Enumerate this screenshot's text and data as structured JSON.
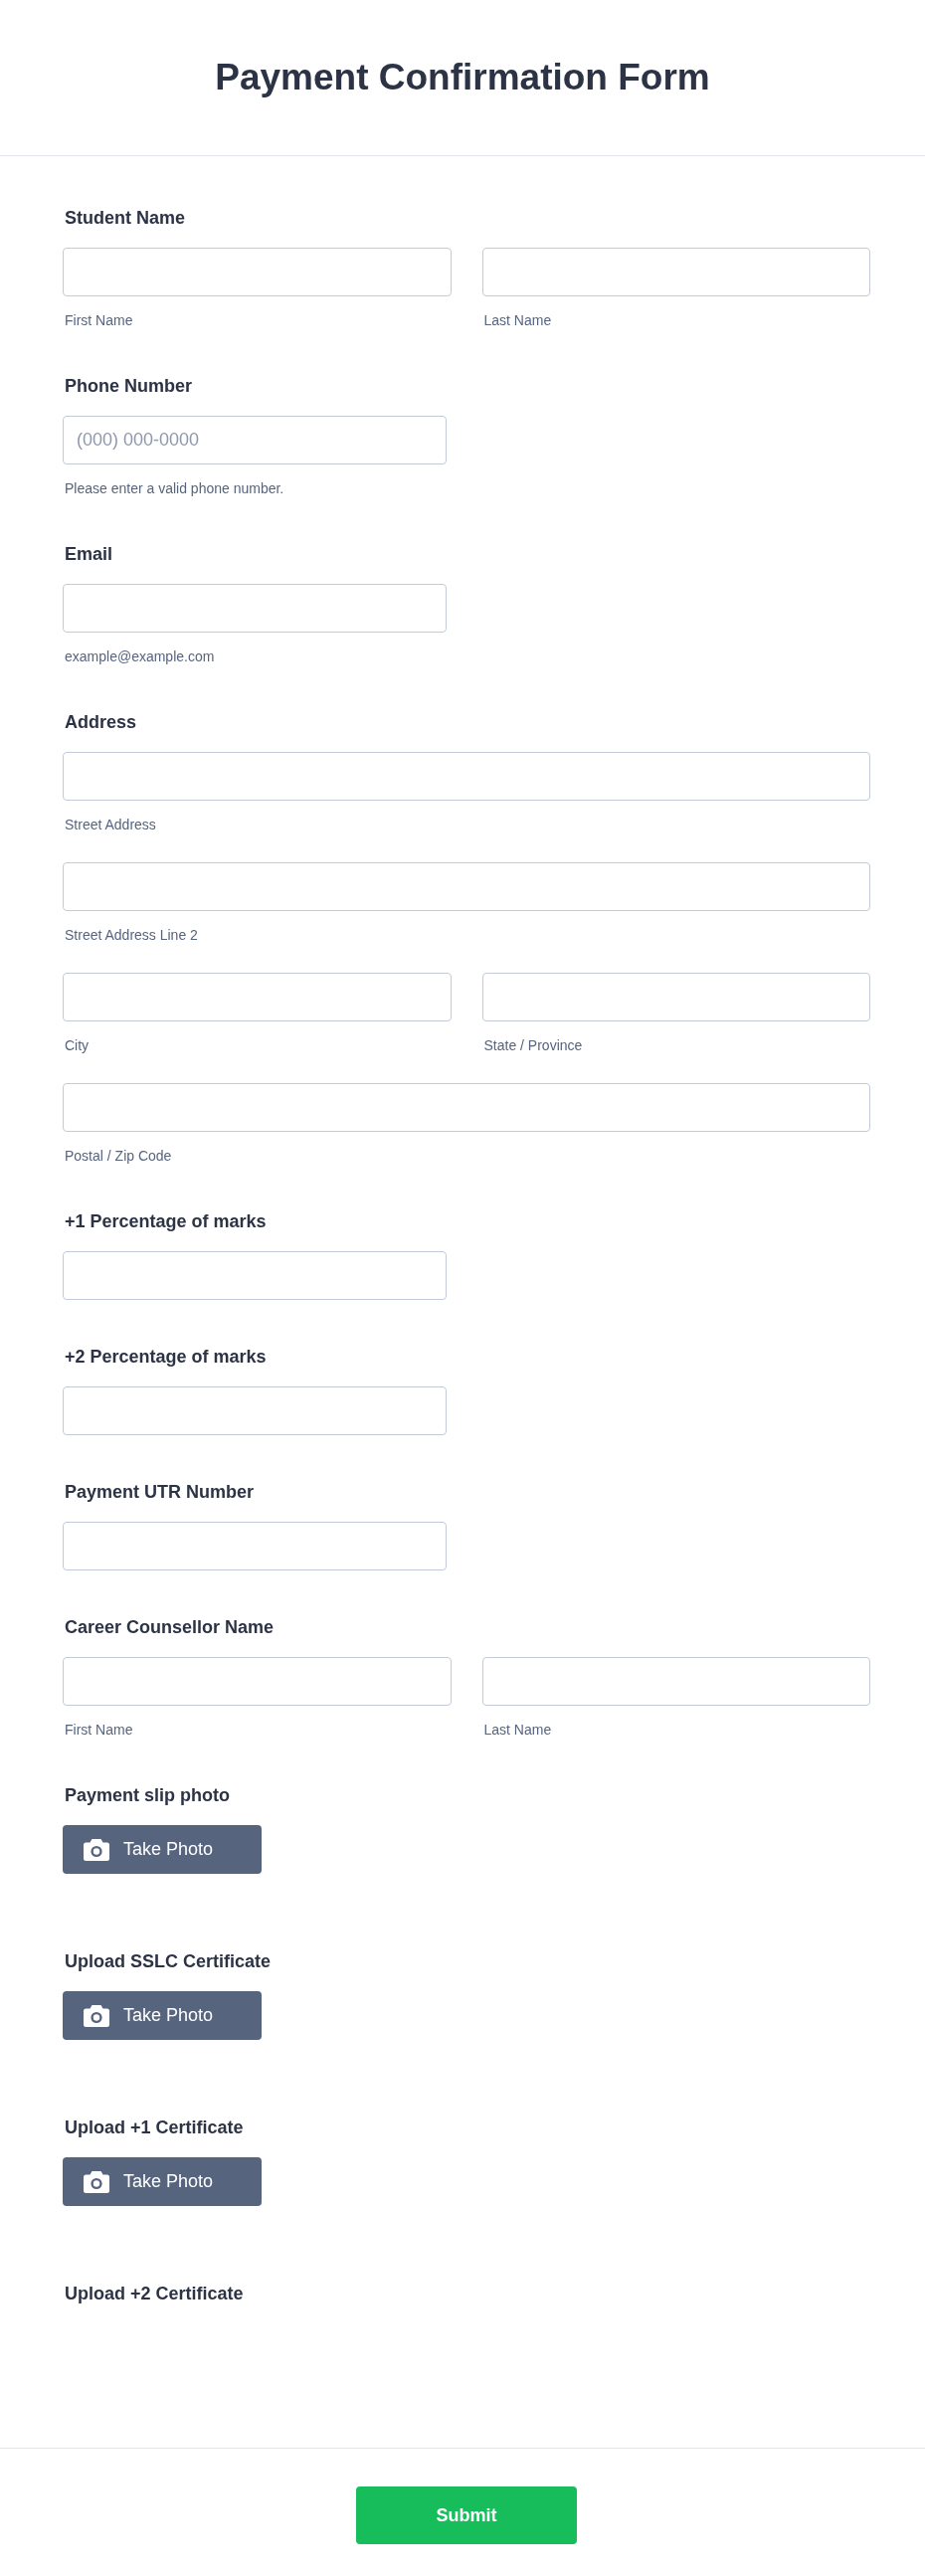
{
  "title": "Payment Confirmation Form",
  "questions": [
    {
      "kind": "name",
      "label": "Student Name",
      "fields": [
        {
          "sublabel": "First Name"
        },
        {
          "sublabel": "Last Name"
        }
      ]
    },
    {
      "kind": "short",
      "label": "Phone Number",
      "placeholder": "(000) 000-0000",
      "sublabel": "Please enter a valid phone number."
    },
    {
      "kind": "short",
      "label": "Email",
      "sublabel": "example@example.com"
    },
    {
      "kind": "address",
      "label": "Address",
      "rows": [
        {
          "fields": [
            {
              "sublabel": "Street Address"
            }
          ]
        },
        {
          "fields": [
            {
              "sublabel": "Street Address Line 2"
            }
          ]
        },
        {
          "fields": [
            {
              "sublabel": "City"
            },
            {
              "sublabel": "State / Province"
            }
          ]
        },
        {
          "fields": [
            {
              "sublabel": "Postal / Zip Code"
            }
          ]
        }
      ]
    },
    {
      "kind": "short",
      "label": "+1 Percentage of marks"
    },
    {
      "kind": "short",
      "label": "+2 Percentage of marks"
    },
    {
      "kind": "short",
      "label": "Payment UTR Number"
    },
    {
      "kind": "name",
      "label": "Career Counsellor Name",
      "fields": [
        {
          "sublabel": "First Name"
        },
        {
          "sublabel": "Last Name"
        }
      ]
    },
    {
      "kind": "photo",
      "label": "Payment slip photo",
      "button": "Take Photo"
    },
    {
      "kind": "photo",
      "label": "Upload SSLC Certificate",
      "button": "Take Photo"
    },
    {
      "kind": "photo",
      "label": "Upload +1 Certificate",
      "button": "Take Photo"
    },
    {
      "kind": "photo",
      "label": "Upload +2 Certificate"
    }
  ],
  "submit": "Submit"
}
